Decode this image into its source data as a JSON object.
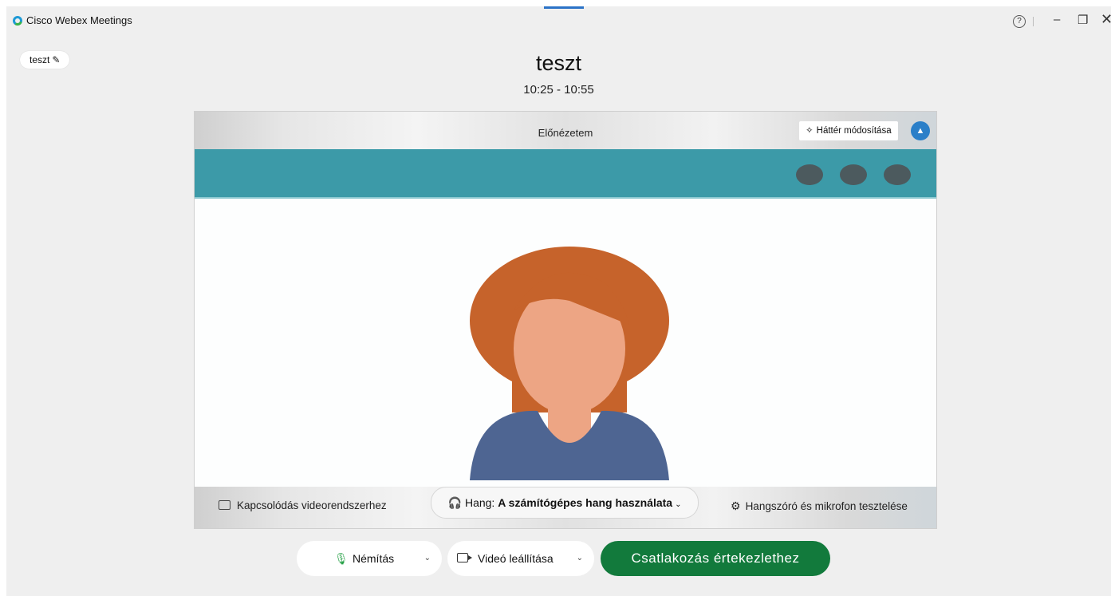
{
  "app": {
    "title": "Cisco Webex Meetings",
    "logo_icon": "webex-logo-icon"
  },
  "window_controls": {
    "help": "?",
    "minimize": "–",
    "maximize": "❐",
    "close": "✕"
  },
  "user": {
    "name": "teszt",
    "edit_icon": "pencil-icon"
  },
  "meeting": {
    "title": "teszt",
    "time": "10:25 - 10:55"
  },
  "preview": {
    "label": "Előnézetem",
    "background_button": "Háttér módosítása",
    "blur_icon": "person-blur-icon"
  },
  "audio": {
    "connect_video": "Kapcsolódás videorendszerhez",
    "audio_prefix": "Hang:",
    "audio_option": "A számítógépes hang használata",
    "speaker_test": "Hangszóró és mikrofon tesztelése"
  },
  "controls": {
    "mute": "Némítás",
    "stop_video": "Videó leállítása",
    "join": "Csatlakozás értekezlethez"
  },
  "colors": {
    "join_green": "#127a3c",
    "accent_blue": "#2b7fc8",
    "banner_teal": "#3c9aa8",
    "hair": "#c6632b",
    "skin": "#eda584",
    "shirt": "#4e6592"
  }
}
